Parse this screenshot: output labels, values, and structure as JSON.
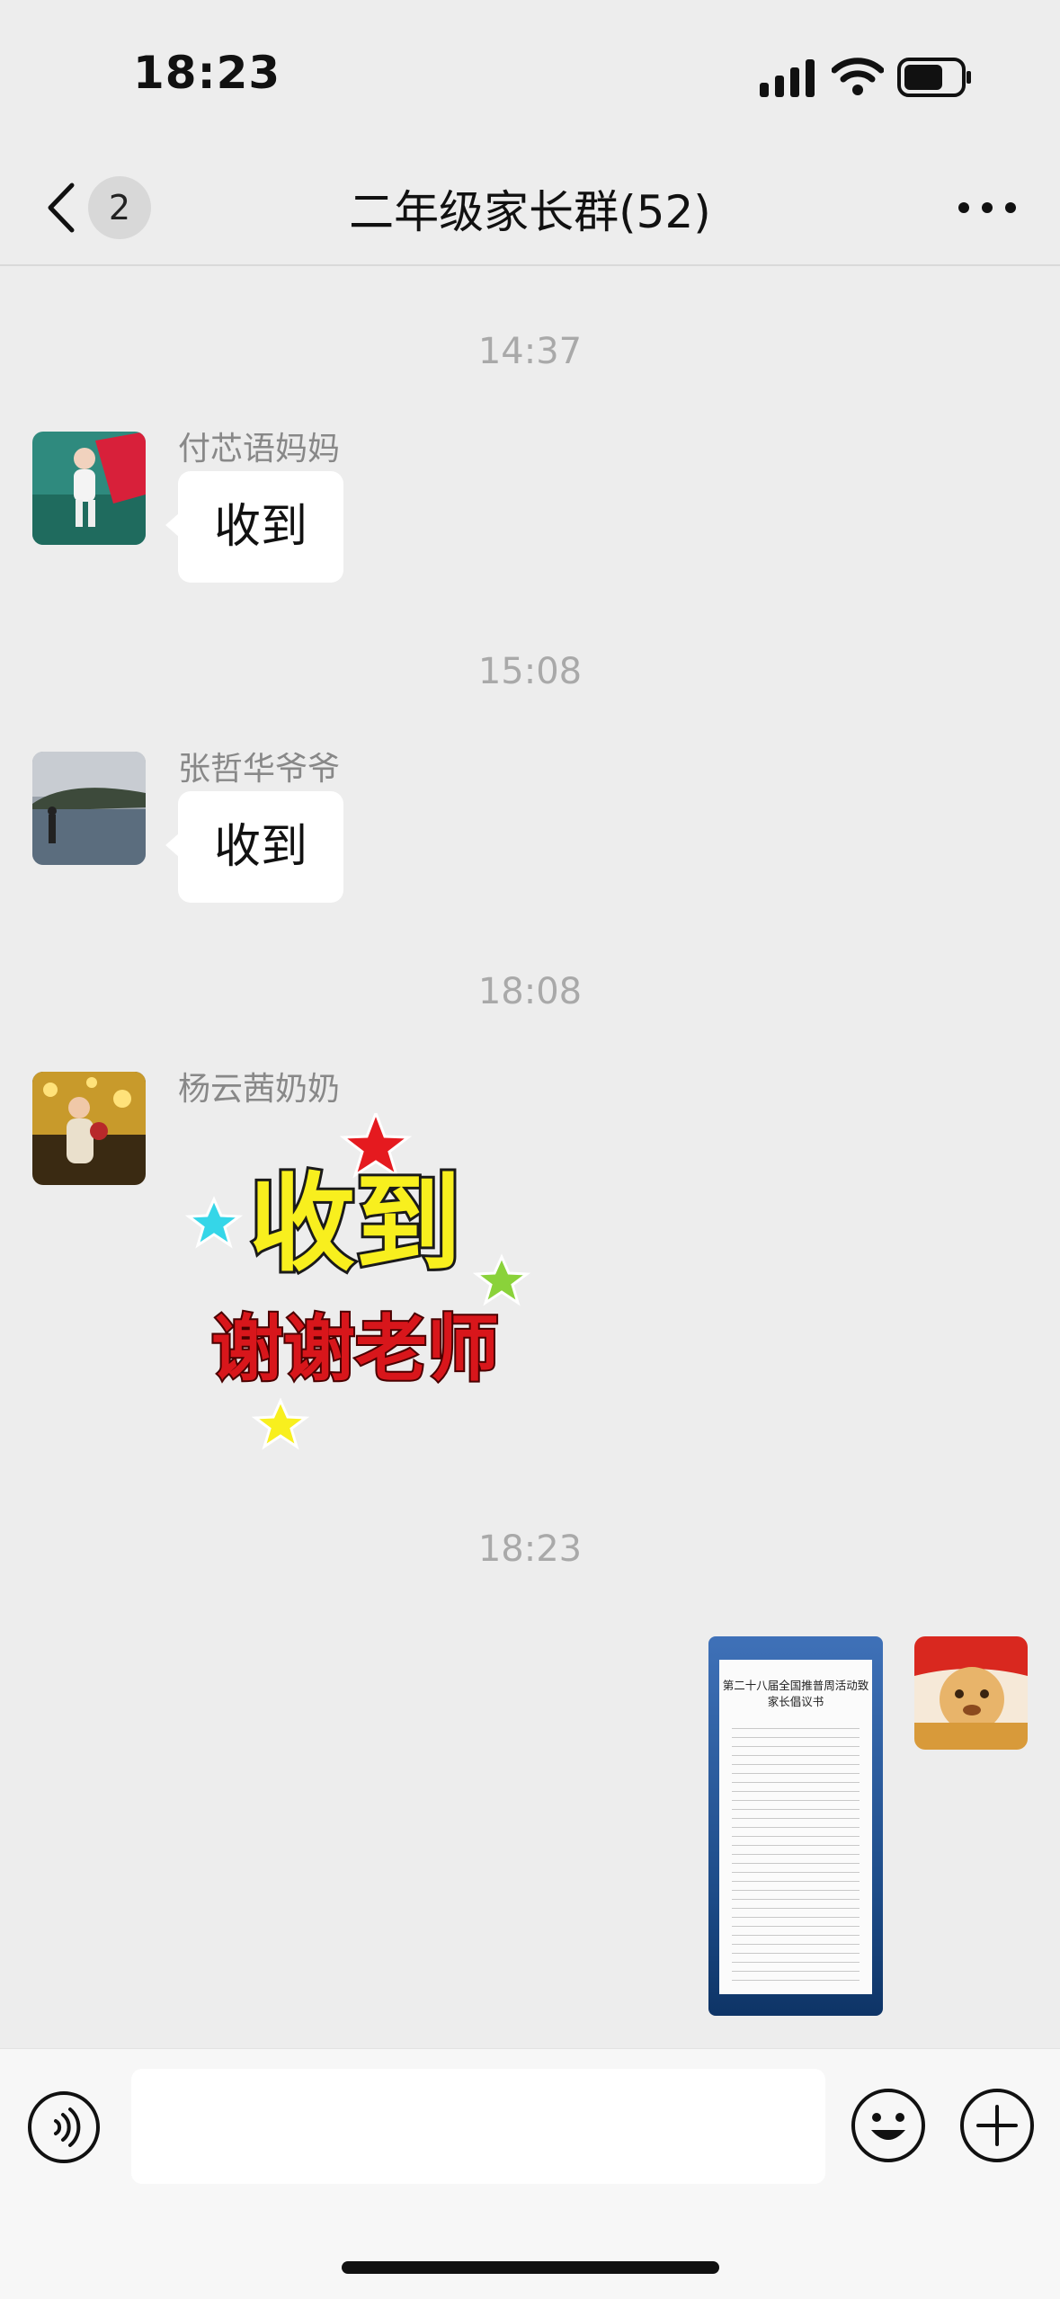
{
  "status_bar": {
    "time": "18:23",
    "icons": [
      "cellular-signal-icon",
      "wifi-icon",
      "battery-icon"
    ]
  },
  "nav_bar": {
    "back_icon": "chevron-left-icon",
    "unread_count": "2",
    "title": "二年级家长群(52)",
    "more_icon": "more-dots-icon"
  },
  "messages": [
    {
      "time": "14:37",
      "sender": "付芯语妈妈",
      "text": "收到"
    },
    {
      "time": "15:08",
      "sender": "张哲华爷爷",
      "text": "收到"
    },
    {
      "time": "18:08",
      "sender": "杨云茜奶奶",
      "sticker_line1": "收到",
      "sticker_line2": "谢谢老师"
    },
    {
      "time": "18:23",
      "sender": "self",
      "image_title": "第二十八届全国推普周活动致家长倡议书"
    }
  ],
  "input_bar": {
    "icons": [
      "voice-icon",
      "emoji-icon",
      "plus-icon"
    ],
    "placeholder": ""
  },
  "colors": {
    "background": "#ededed",
    "bubble": "#ffffff",
    "sticker_yellow": "#f8ef1e",
    "sticker_red": "#d8161b"
  }
}
